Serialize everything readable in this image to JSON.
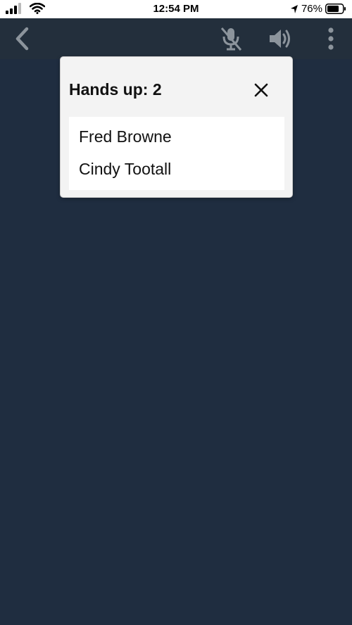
{
  "status_bar": {
    "time": "12:54 PM",
    "battery_percent": "76%",
    "battery_level": 0.76
  },
  "top_bar": {
    "icons": [
      "back-icon",
      "mic-muted-icon",
      "speaker-icon",
      "more-vertical-icon"
    ]
  },
  "dialog": {
    "title": "Hands up: 2",
    "close_icon": "close-icon",
    "items": [
      {
        "label": "Fred Browne"
      },
      {
        "label": "Cindy Tootall"
      }
    ]
  },
  "colors": {
    "background": "#1f2d40",
    "top_bar": "#232f3c",
    "icon_gray": "#8c949c",
    "dialog_bg": "#f3f3f3",
    "list_bg": "#ffffff"
  }
}
